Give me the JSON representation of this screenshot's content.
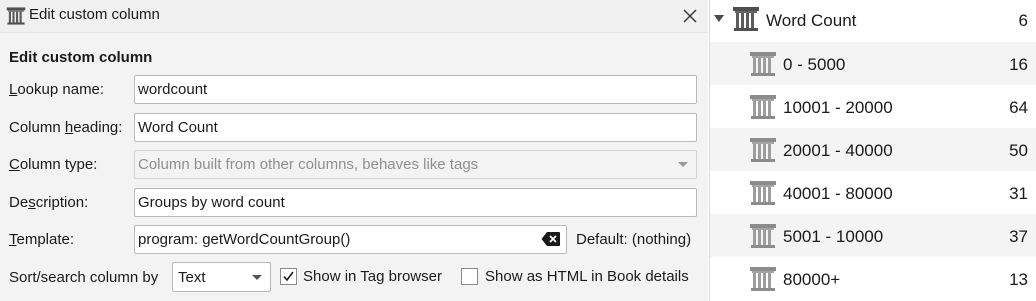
{
  "dialog": {
    "title": "Edit custom column",
    "close_icon": "close-icon",
    "section_heading": "Edit custom column",
    "lookup": {
      "label_u": "L",
      "label_rest": "ookup name:",
      "value": "wordcount"
    },
    "heading": {
      "label_pre": "Column ",
      "label_u": "h",
      "label_rest": "eading:",
      "value": "Word Count"
    },
    "type": {
      "label_u": "C",
      "label_rest": "olumn type:",
      "value": "Column built from other columns, behaves like tags"
    },
    "description": {
      "label_pre": "De",
      "label_u": "s",
      "label_rest": "cription:",
      "value": "Groups by word count"
    },
    "template": {
      "label_u": "T",
      "label_rest": "emplate:",
      "value": "program: getWordCountGroup()",
      "default_text": "Default: (nothing)"
    },
    "sort": {
      "label": "Sort/search column by",
      "selected": "Text"
    },
    "show_in_tag_browser": {
      "label": "Show in Tag browser",
      "checked": true
    },
    "show_as_html": {
      "label": "Show as HTML in Book details",
      "checked": false
    }
  },
  "tag_browser": {
    "category": {
      "name": "Word Count",
      "count": "6"
    },
    "items": [
      {
        "name": "0 - 5000",
        "count": "16"
      },
      {
        "name": "10001 - 20000",
        "count": "64"
      },
      {
        "name": "20001 - 40000",
        "count": "50"
      },
      {
        "name": "40001 - 80000",
        "count": "31"
      },
      {
        "name": "5001 - 10000",
        "count": "37"
      },
      {
        "name": "80000+",
        "count": "13"
      }
    ]
  }
}
